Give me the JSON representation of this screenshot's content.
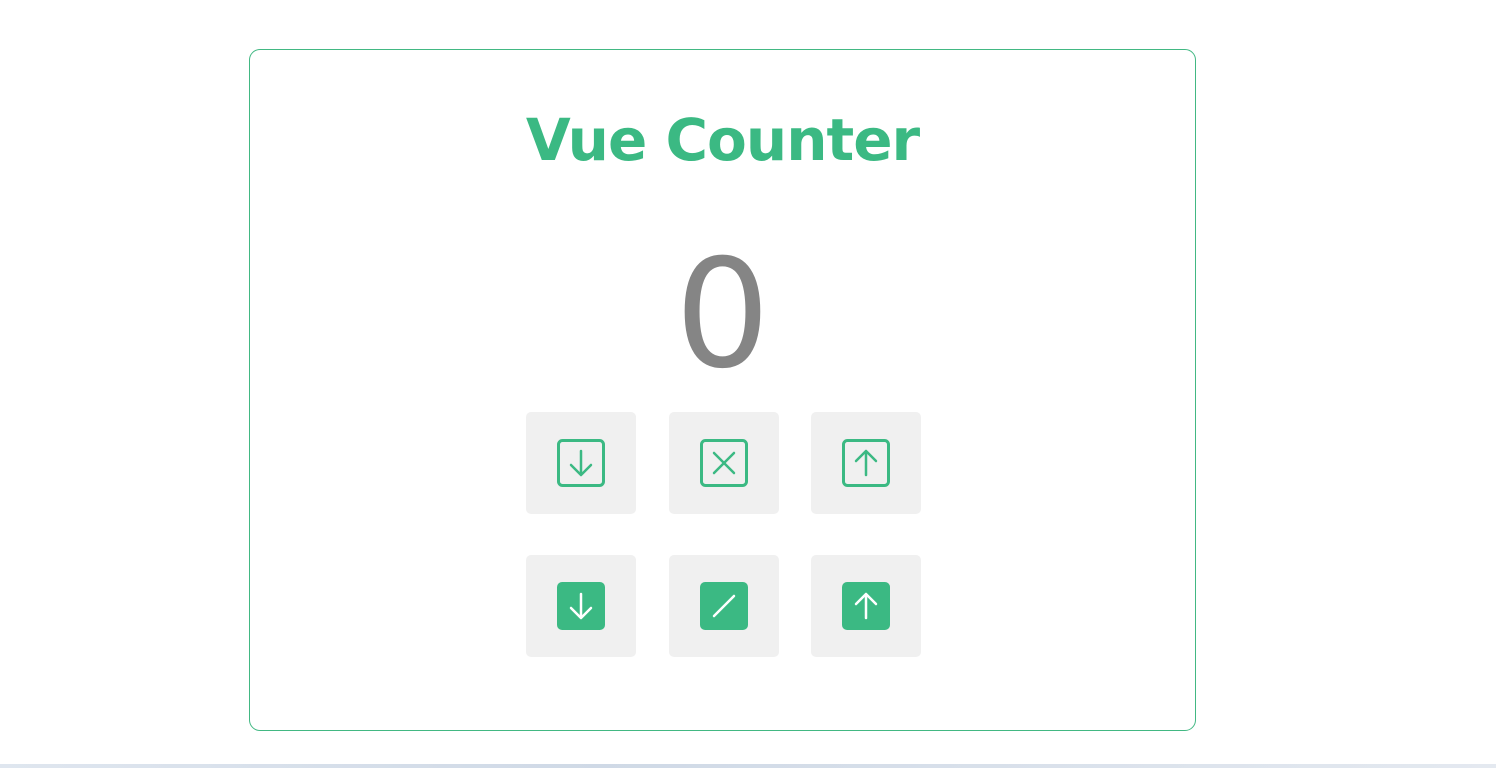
{
  "app": {
    "title": "Vue Counter",
    "count": "0"
  },
  "colors": {
    "accent": "#3bb983",
    "count_text": "#858585",
    "button_bg": "#f0f0f0",
    "border": "#42b883"
  },
  "buttons": [
    {
      "name": "decrement-outline-button",
      "icon": "arrow-down-square-outline-icon"
    },
    {
      "name": "reset-outline-button",
      "icon": "x-square-outline-icon"
    },
    {
      "name": "increment-outline-button",
      "icon": "arrow-up-square-outline-icon"
    },
    {
      "name": "decrement-filled-button",
      "icon": "arrow-down-square-filled-icon"
    },
    {
      "name": "slash-filled-button",
      "icon": "slash-square-filled-icon"
    },
    {
      "name": "increment-filled-button",
      "icon": "arrow-up-square-filled-icon"
    }
  ]
}
